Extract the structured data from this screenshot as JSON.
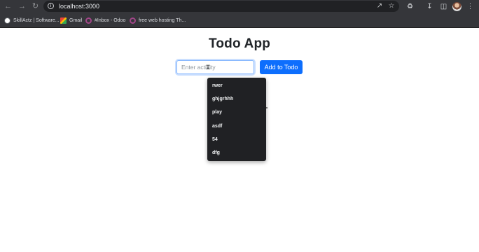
{
  "browser": {
    "url": "localhost:3000",
    "bookmarks": [
      {
        "label": "SkillActz | Software...",
        "icon": "skillactz-icon"
      },
      {
        "label": "Gmail",
        "icon": "gmail-icon"
      },
      {
        "label": "#Inbox - Odoo",
        "icon": "odoo-icon"
      },
      {
        "label": "free web hosting Th...",
        "icon": "odoo-icon"
      }
    ]
  },
  "app": {
    "title": "Todo App",
    "input_placeholder": "Enter activity",
    "add_button_label": "Add to Todo",
    "accent_color": "#0d6efd"
  },
  "autocomplete": {
    "items": [
      "rwer",
      "ghjgrhhh",
      "play",
      "asdf",
      "54",
      "dfg"
    ]
  }
}
